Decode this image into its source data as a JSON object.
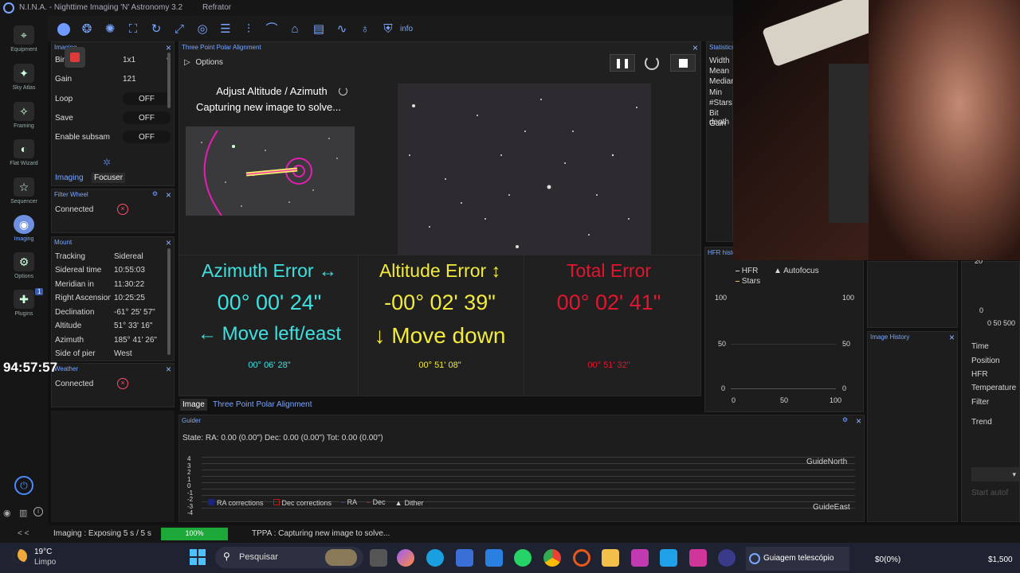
{
  "window": {
    "title": "N.I.N.A. - Nighttime Imaging 'N' Astronomy 3.2",
    "profile": "Refrator"
  },
  "toolbar": {
    "info_label": "info"
  },
  "sidebar": {
    "items": [
      {
        "label": "Equipment",
        "icon": "equipment-icon"
      },
      {
        "label": "Sky Atlas",
        "icon": "sky-atlas-icon"
      },
      {
        "label": "Framing",
        "icon": "framing-icon"
      },
      {
        "label": "Flat Wizard",
        "icon": "flat-wizard-icon"
      },
      {
        "label": "Sequencer",
        "icon": "sequencer-icon"
      },
      {
        "label": "Imaging",
        "icon": "imaging-icon"
      },
      {
        "label": "Options",
        "icon": "options-icon"
      },
      {
        "label": "Plugins",
        "icon": "plugins-icon",
        "badge": "1"
      }
    ],
    "collapse": "< <"
  },
  "timer": "94:57:57",
  "imaging_panel": {
    "title": "Imaging",
    "bin_label": "Binning",
    "bin_value": "1x1",
    "gain_label": "Gain",
    "gain_value": "121",
    "loop_label": "Loop",
    "loop_value": "OFF",
    "save_label": "Save",
    "save_value": "OFF",
    "subsample_label": "Enable subsam",
    "subsample_value": "OFF",
    "tab_imaging": "Imaging",
    "tab_focuser": "Focuser"
  },
  "filter_wheel": {
    "title": "Filter Wheel",
    "status": "Connected"
  },
  "mount": {
    "title": "Mount",
    "rows": [
      {
        "k": "Tracking",
        "v": "Sidereal"
      },
      {
        "k": "Sidereal time",
        "v": "10:55:03"
      },
      {
        "k": "Meridian in",
        "v": "11:30:22"
      },
      {
        "k": "Right Ascension",
        "v": "10:25:25"
      },
      {
        "k": "Declination",
        "v": "-61° 25' 57\""
      },
      {
        "k": "Altitude",
        "v": "51° 33' 16\""
      },
      {
        "k": "Azimuth",
        "v": "185° 41' 26\""
      },
      {
        "k": "Side of pier",
        "v": "West"
      }
    ]
  },
  "weather": {
    "title": "Weather",
    "status": "Connected"
  },
  "tppa": {
    "title": "Three Point Polar Alignment",
    "options_label": "Options",
    "adjust_label": "Adjust Altitude / Azimuth",
    "capturing_label": "Capturing new image to solve...",
    "azimuth_title": "Azimuth Error ↔",
    "azimuth_value": "00° 00' 24\"",
    "azimuth_hint": "← Move left/east",
    "azimuth_sub": "00° 06' 28\"",
    "altitude_title": "Altitude Error ↕",
    "altitude_value": "-00° 02' 39\"",
    "altitude_hint": "↓ Move down",
    "altitude_sub": "00° 51' 08\"",
    "total_title": "Total Error",
    "total_value": "00° 02' 41\"",
    "total_sub": "00° 51' 32\"",
    "tab_image": "Image",
    "tab_tppa": "Three Point Polar Alignment"
  },
  "statistics": {
    "title": "Statistics",
    "rows": [
      "Width",
      "Mean",
      "Median",
      "Min",
      "#Stars",
      "Bit depth",
      "Gain"
    ]
  },
  "hfr_history": {
    "title": "HFR history",
    "legend_hfr": "HFR",
    "legend_stars": "Stars",
    "legend_autofocus": "Autofocus",
    "y_ticks": [
      "100",
      "50",
      "0"
    ],
    "x_ticks": [
      "0",
      "50",
      "100"
    ]
  },
  "image_history": {
    "title": "Image History"
  },
  "right_list": {
    "items": [
      "Time",
      "Position",
      "HFR",
      "Temperature",
      "Filter",
      "Trend"
    ],
    "top_tick": "20",
    "zero": "0",
    "x_axis": "0 50 500",
    "start_autofocus": "Start autof"
  },
  "guider": {
    "title": "Guider",
    "state": "State:  RA: 0.00 (0.00\")  Dec: 0.00 (0.00\")  Tot: 0.00 (0.00\")",
    "y_ticks": [
      "4",
      "3",
      "2",
      "1",
      "0",
      "-1",
      "-2",
      "-3",
      "-4"
    ],
    "north_label": "GuideNorth",
    "east_label": "GuideEast",
    "legend": [
      "RA corrections",
      "Dec corrections",
      "RA",
      "Dec",
      "Dither"
    ]
  },
  "statusbar": {
    "imaging": "Imaging :  Exposing 5 s / 5 s",
    "progress_pct": 100,
    "progress_label": "100%",
    "tppa": "TPPA :  Capturing new image to solve..."
  },
  "taskbar": {
    "weather_temp": "19°C",
    "weather_desc": "Limpo",
    "search_label": "Pesquisar",
    "active_window": "Guiagem telescópio",
    "ticker1": "$0(0%)",
    "ticker2": "$1,500"
  },
  "colors": {
    "azimuth": "#3fe0e0",
    "altitude": "#f2ea3c",
    "total": "#e2162f",
    "accent": "#7aa6ff",
    "progress": "#1fa83a"
  }
}
